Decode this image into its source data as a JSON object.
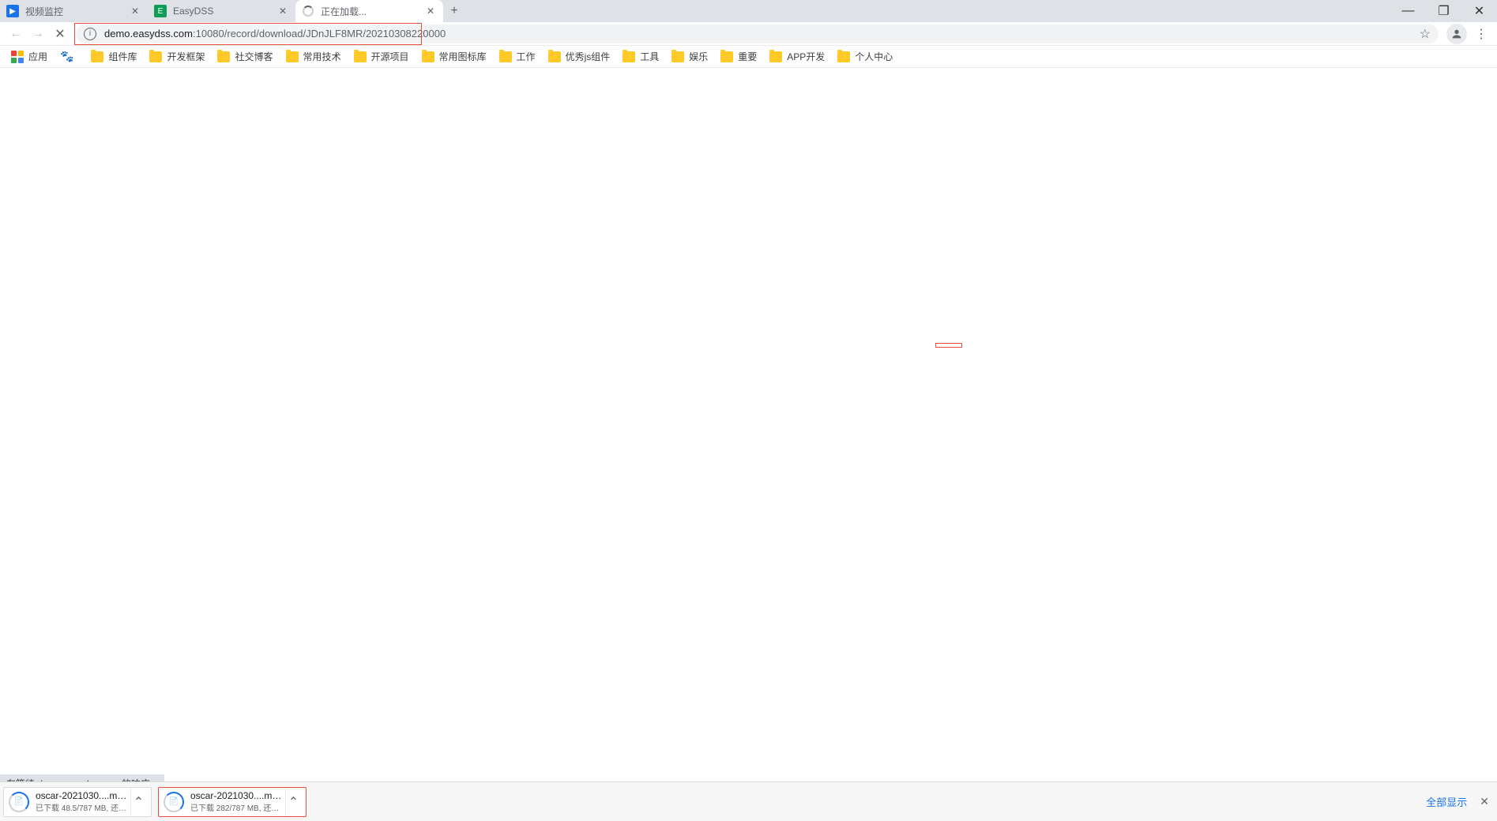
{
  "tabs": [
    {
      "title": "视频监控",
      "favicon": "blue"
    },
    {
      "title": "EasyDSS",
      "favicon": "green"
    },
    {
      "title": "正在加载...",
      "favicon": "spinner",
      "active": true
    }
  ],
  "url": {
    "host": "demo.easydss.com",
    "path": ":10080/record/download/JDnJLF8MR/20210308220000"
  },
  "bookmarks": {
    "apps": "应用",
    "paw": "",
    "items": [
      "组件库",
      "开发框架",
      "社交博客",
      "常用技术",
      "开源项目",
      "常用图标库",
      "工作",
      "优秀js组件",
      "工具",
      "娱乐",
      "重要",
      "APP开发",
      "个人中心"
    ]
  },
  "status_text": "在等待 demo.easydss.com 的响应...",
  "downloads": [
    {
      "name": "oscar-2021030....mp4",
      "status": "已下载 48.5/787 MB, 还需..."
    },
    {
      "name": "oscar-2021030....mp4",
      "status": "已下载 282/787 MB, 还需...",
      "highlighted": true
    }
  ],
  "downloads_footer": {
    "show_all": "全部显示"
  }
}
